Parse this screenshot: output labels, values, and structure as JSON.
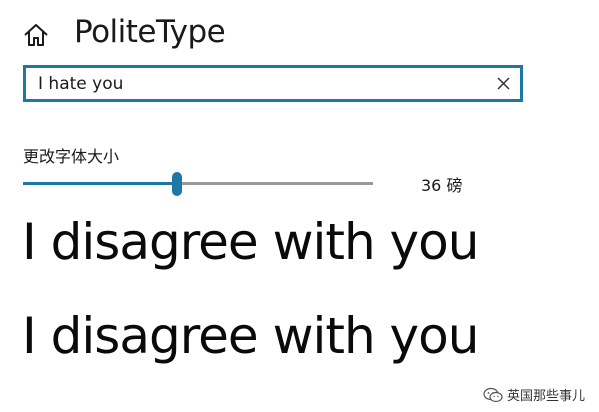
{
  "header": {
    "home_icon": "home-icon",
    "title": "PoliteType"
  },
  "search": {
    "value": "I hate you",
    "clear_icon": "close-icon"
  },
  "font_size": {
    "label": "更改字体大小",
    "value": 36,
    "display": "36 磅",
    "slider_fraction": 0.44
  },
  "previews": [
    "I disagree with you",
    "I disagree with you"
  ],
  "watermark": {
    "icon": "wechat-icon",
    "text": "英国那些事儿"
  },
  "colors": {
    "accent": "#1e78a6",
    "track": "#9a9a9a",
    "text": "#111111",
    "background": "#ffffff"
  }
}
